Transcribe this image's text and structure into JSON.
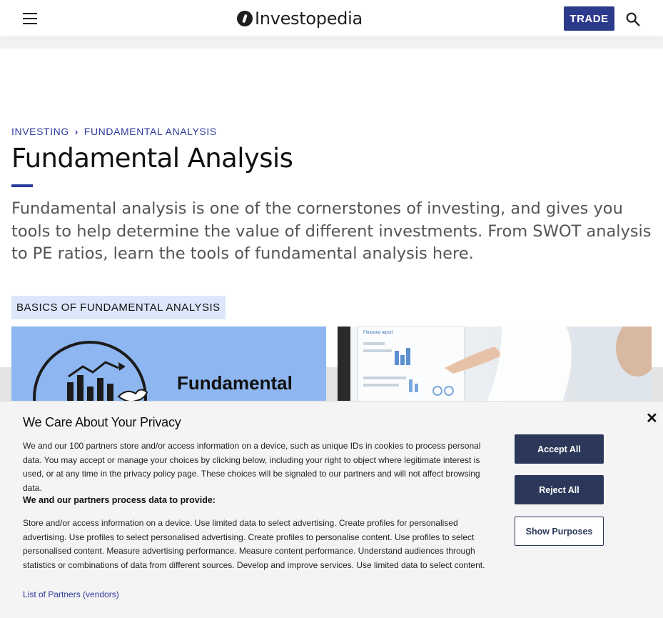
{
  "header": {
    "logo_text": "Investopedia",
    "trade_label": "TRADE"
  },
  "breadcrumb": {
    "items": [
      "INVESTING",
      "FUNDAMENTAL ANALYSIS"
    ],
    "separator": "›"
  },
  "page": {
    "title": "Fundamental Analysis",
    "intro": "Fundamental analysis is one of the cornerstones of investing, and gives you tools to help determine the value of different investments. From SWOT analysis to PE ratios, learn the tools of fundamental analysis here.",
    "section_tag": "BASICS OF FUNDAMENTAL ANALYSIS"
  },
  "cards": [
    {
      "image_text": "Fundamental"
    },
    {
      "image_text": "Financial report"
    }
  ],
  "privacy": {
    "title": "We Care About Your Privacy",
    "text": "We and our 100 partners store and/or access information on a device, such as unique IDs in cookies to process personal data. You may accept or manage your choices by clicking below, including your right to object where legitimate interest is used, or at any time in the privacy policy page. These choices will be signaled to our partners and will not affect browsing data.",
    "subheading": "We and our partners process data to provide:",
    "purposes": "Store and/or access information on a device. Use limited data to select advertising. Create profiles for personalised advertising. Use profiles to select personalised advertising. Create profiles to personalise content. Use profiles to select personalised content. Measure advertising performance. Measure content performance. Understand audiences through statistics or combinations of data from different sources. Develop and improve services. Use limited data to select content.",
    "partners_link": "List of Partners (vendors)",
    "close": "✕",
    "accept_label": "Accept All",
    "reject_label": "Reject All",
    "show_label": "Show Purposes"
  },
  "colors": {
    "brand_blue": "#2c3a9c",
    "button_navy": "#2b3859",
    "tag_bg": "#dde7fb"
  }
}
